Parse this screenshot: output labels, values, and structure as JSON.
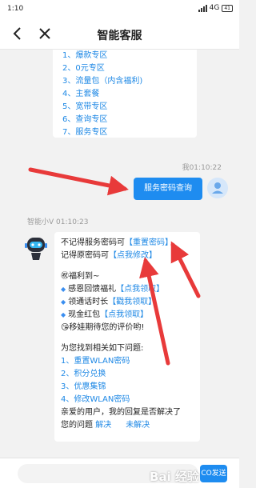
{
  "status_bar": {
    "time": "1:10",
    "network": "4G",
    "battery": "41"
  },
  "header": {
    "title": "智能客服"
  },
  "menu_items": [
    "1、爆款专区",
    "2、0元专区",
    "3、流量包（内含福利)",
    "4、主套餐",
    "5、宽带专区",
    "6、查询专区",
    "7、服务专区"
  ],
  "user_message": {
    "timestamp": "我01:10:22",
    "text": "服务密码查询"
  },
  "bot": {
    "name_time": "智能小V 01:10:23"
  },
  "reply": {
    "line1_text": "不记得服务密码可",
    "line1_link": "【重置密码】",
    "line2_text": "记得原密码可",
    "line2_link": "【点我修改】",
    "welfare_title": "㊗福利到~",
    "perk1_text": "感恩回馈福礼",
    "perk1_link": "【点我领取】",
    "perk2_text": "领通话时长",
    "perk2_link": "【戳我领取】",
    "perk3_text": "现金红包",
    "perk3_link": "【点我领取】",
    "rate_text": "😘移娃期待您的评价哟!",
    "related_title": "为您找到相关如下问题:",
    "related_items": [
      "1、重置WLAN密码",
      "2、积分兑换",
      "3、优惠集锦",
      "4、修改WLAN密码"
    ],
    "feedback_line1": "亲爱的用户，我的回复是否解决了",
    "feedback_line2": "您的问题",
    "solved": "解决",
    "unsolved": "未解决"
  },
  "composer": {
    "placeholder": "",
    "send_label": "CO发送"
  },
  "watermark": {
    "text": "Bai 经验"
  },
  "colors": {
    "accent": "#1e8cf0",
    "link": "#1e88e5",
    "arrow": "#e83a3a"
  }
}
